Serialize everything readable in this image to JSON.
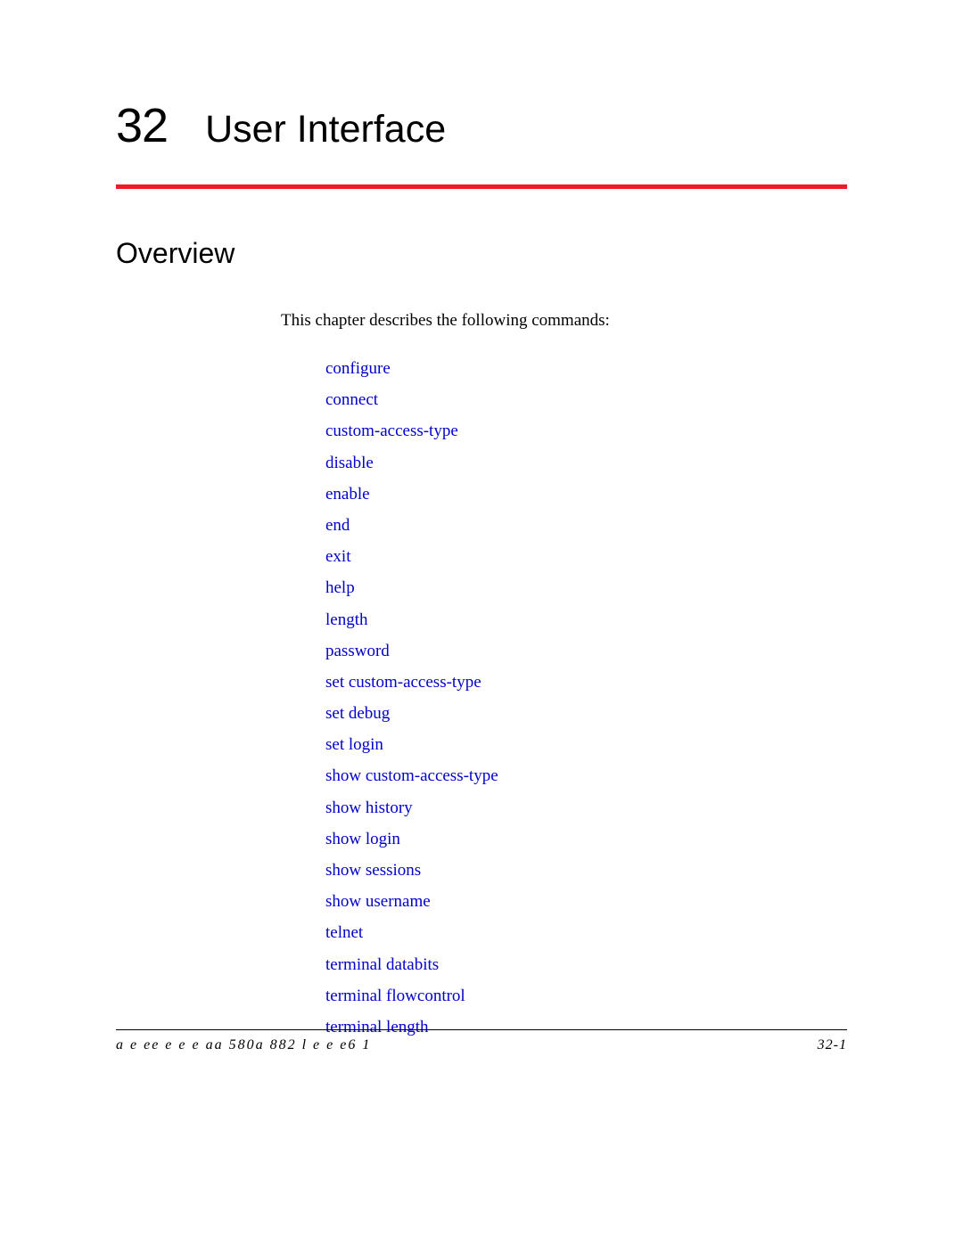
{
  "chapter": {
    "number": "32",
    "title": "User Interface"
  },
  "section": {
    "heading": "Overview",
    "intro": "This chapter describes the following commands:"
  },
  "commands": [
    "configure",
    "connect",
    "custom-access-type",
    "disable",
    "enable",
    "end",
    "exit",
    "help",
    "length",
    "password",
    "set custom-access-type",
    "set debug",
    "set login",
    "show custom-access-type",
    "show history",
    "show login",
    "show sessions",
    "show username",
    "telnet",
    "terminal databits",
    "terminal flowcontrol",
    "terminal length"
  ],
  "footer": {
    "left": "a    e ee  e     e   e  aa  580a   882   l e   e     e6 1",
    "right": "32-1"
  }
}
